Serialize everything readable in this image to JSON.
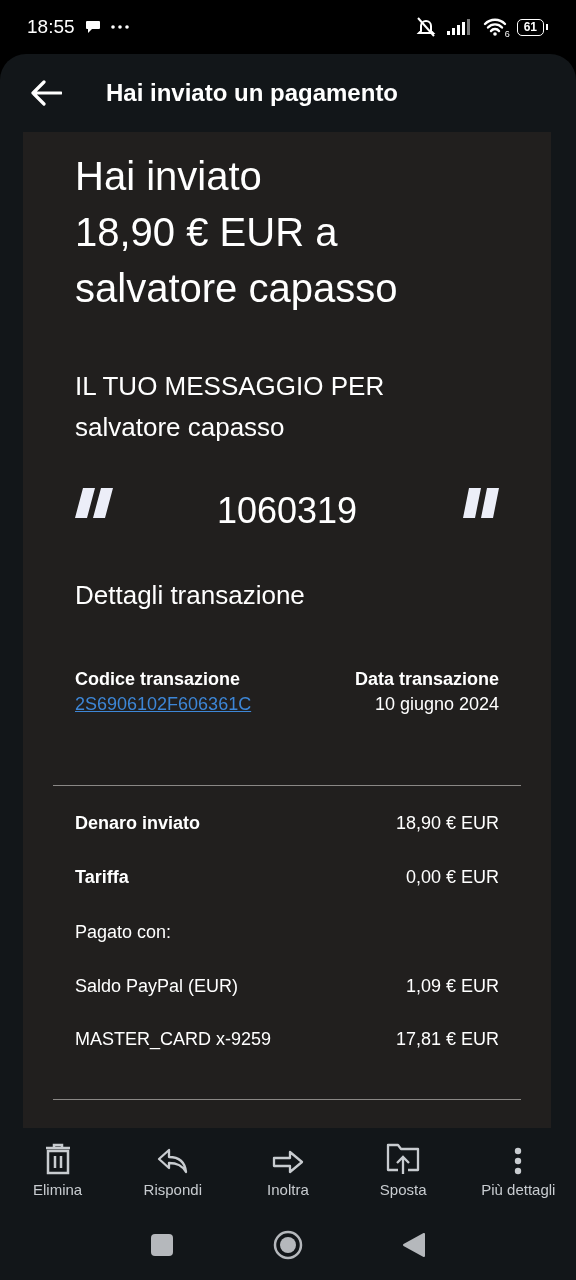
{
  "status_bar": {
    "time": "18:55",
    "wifi_badge": "6",
    "battery": "61"
  },
  "header": {
    "title": "Hai inviato un pagamento"
  },
  "headline_lines": [
    "Hai inviato",
    "18,90 € EUR a",
    "salvatore capasso"
  ],
  "message": {
    "label": "IL TUO MESSAGGIO PER",
    "recipient": "salvatore capasso",
    "text": "1060319"
  },
  "details": {
    "title": "Dettagli transazione",
    "code_label": "Codice transazione",
    "code": "2S6906102F606361C",
    "date_label": "Data transazione",
    "date": "10 giugno 2024"
  },
  "summary_rows": [
    {
      "kind": "total",
      "label": "Denaro inviato",
      "amount": "18,90 € EUR"
    },
    {
      "kind": "total",
      "label": "Tariffa",
      "amount": "0,00 € EUR"
    },
    {
      "kind": "heading",
      "label": "Pagato con:"
    },
    {
      "kind": "funding",
      "label": "Saldo PayPal (EUR)",
      "amount": "1,09 € EUR"
    },
    {
      "kind": "funding",
      "label": "MASTER_CARD x-9259",
      "amount": "17,81 € EUR"
    }
  ],
  "toolbar": [
    {
      "kind": "delete",
      "label": "Elimina"
    },
    {
      "kind": "reply",
      "label": "Rispondi"
    },
    {
      "kind": "forward",
      "label": "Inoltra"
    },
    {
      "kind": "move",
      "label": "Sposta"
    },
    {
      "kind": "more",
      "label": "Più dettagli"
    }
  ]
}
